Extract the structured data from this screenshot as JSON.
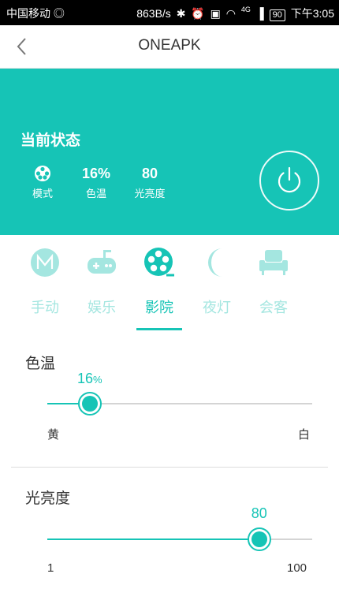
{
  "status_bar": {
    "carrier": "中国移动",
    "net_speed": "863B/s",
    "network_type": "4G",
    "battery": "90",
    "time": "下午3:05"
  },
  "nav": {
    "title": "ONEAPK"
  },
  "status_panel": {
    "title": "当前状态",
    "mode_label": "模式",
    "color_temp_value": "16%",
    "color_temp_label": "色温",
    "brightness_value": "80",
    "brightness_label": "光亮度"
  },
  "modes": [
    {
      "label": "手动",
      "icon": "m-icon",
      "active": false
    },
    {
      "label": "娱乐",
      "icon": "gamepad-icon",
      "active": false
    },
    {
      "label": "影院",
      "icon": "film-reel-icon",
      "active": true
    },
    {
      "label": "夜灯",
      "icon": "moon-icon",
      "active": false
    },
    {
      "label": "会客",
      "icon": "sofa-icon",
      "active": false
    }
  ],
  "color_temp": {
    "label": "色温",
    "value": "16",
    "unit": "%",
    "percent": 16,
    "min_label": "黄",
    "max_label": "白"
  },
  "brightness": {
    "label": "光亮度",
    "value": "80",
    "percent": 80,
    "min_label": "1",
    "max_label": "100"
  },
  "colors": {
    "accent": "#16c4b6",
    "accent_light": "#a4e6e0",
    "track": "#d4d4d4"
  }
}
